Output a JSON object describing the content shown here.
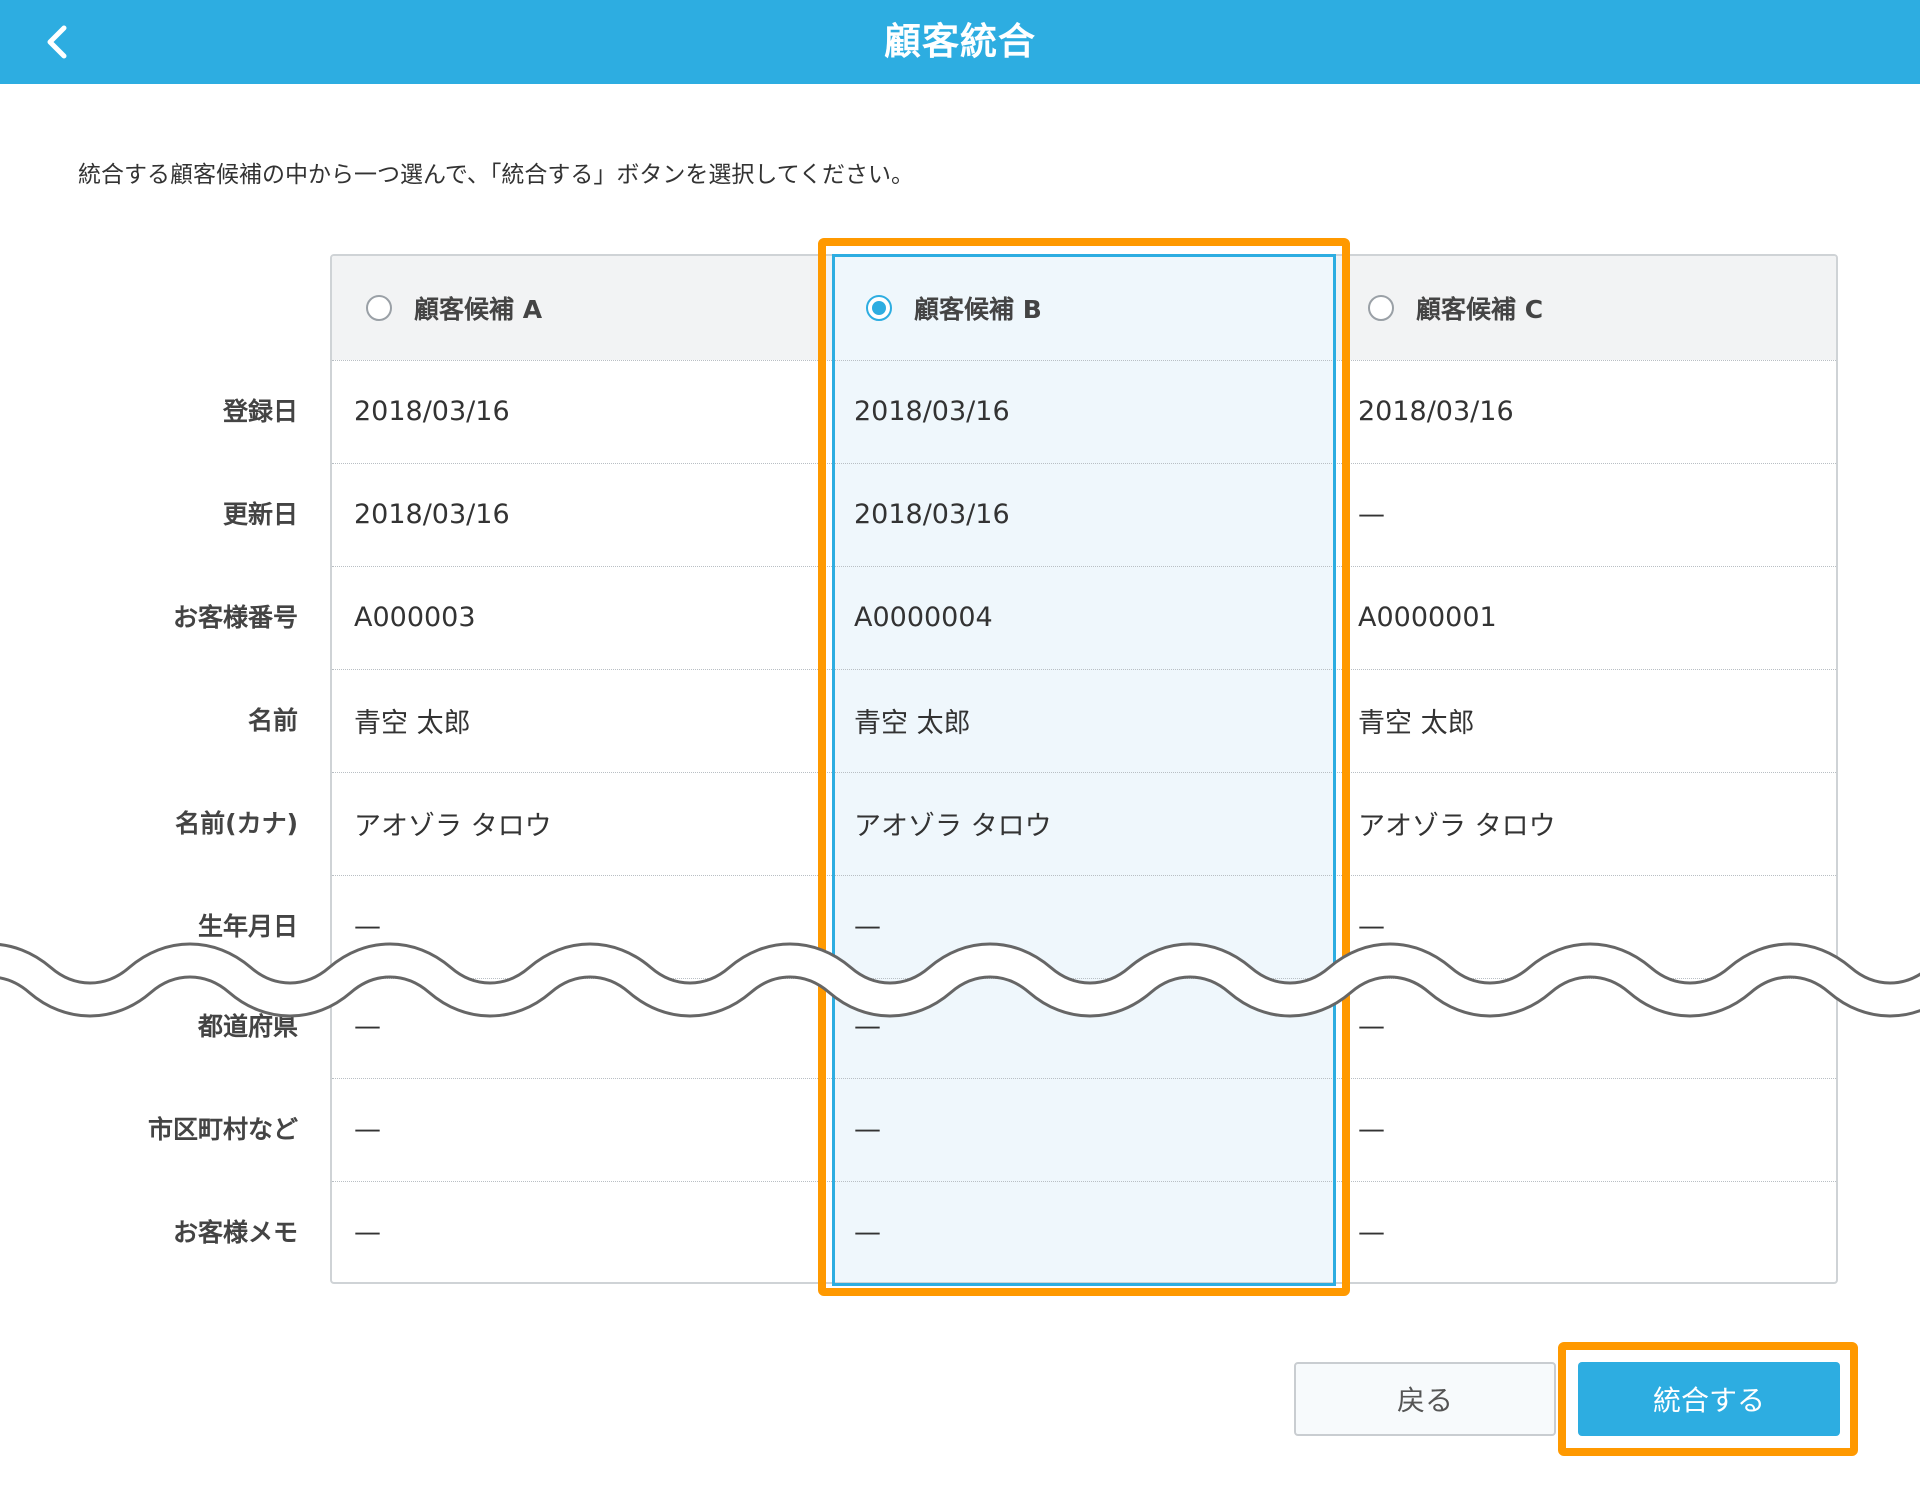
{
  "header": {
    "title": "顧客統合",
    "back_icon": "chevron-left-icon"
  },
  "instruction": "統合する顧客候補の中から一つ選んで、「統合する」ボタンを選択してください。",
  "candidates": [
    {
      "label": "顧客候補 A",
      "selected": false
    },
    {
      "label": "顧客候補 B",
      "selected": true
    },
    {
      "label": "顧客候補 C",
      "selected": false
    }
  ],
  "rows": [
    {
      "label": "登録日",
      "values": [
        "2018/03/16",
        "2018/03/16",
        "2018/03/16"
      ]
    },
    {
      "label": "更新日",
      "values": [
        "2018/03/16",
        "2018/03/16",
        "—"
      ]
    },
    {
      "label": "お客様番号",
      "values": [
        "A000003",
        "A0000004",
        "A0000001"
      ]
    },
    {
      "label": "名前",
      "values": [
        "青空 太郎",
        "青空 太郎",
        "青空 太郎"
      ]
    },
    {
      "label": "名前(カナ)",
      "values": [
        "アオゾラ タロウ",
        "アオゾラ タロウ",
        "アオゾラ タロウ"
      ]
    },
    {
      "label": "生年月日",
      "values": [
        "—",
        "—",
        "—"
      ]
    },
    {
      "label": "都道府県",
      "values": [
        "—",
        "—",
        "—"
      ]
    },
    {
      "label": "市区町村など",
      "values": [
        "—",
        "—",
        "—"
      ]
    },
    {
      "label": "お客様メモ",
      "values": [
        "—",
        "—",
        "—"
      ]
    }
  ],
  "buttons": {
    "back_label": "戻る",
    "merge_label": "統合する"
  },
  "colors": {
    "header": "#2dade1",
    "highlight": "#ff9900",
    "selected_column": "#eff7fc"
  }
}
